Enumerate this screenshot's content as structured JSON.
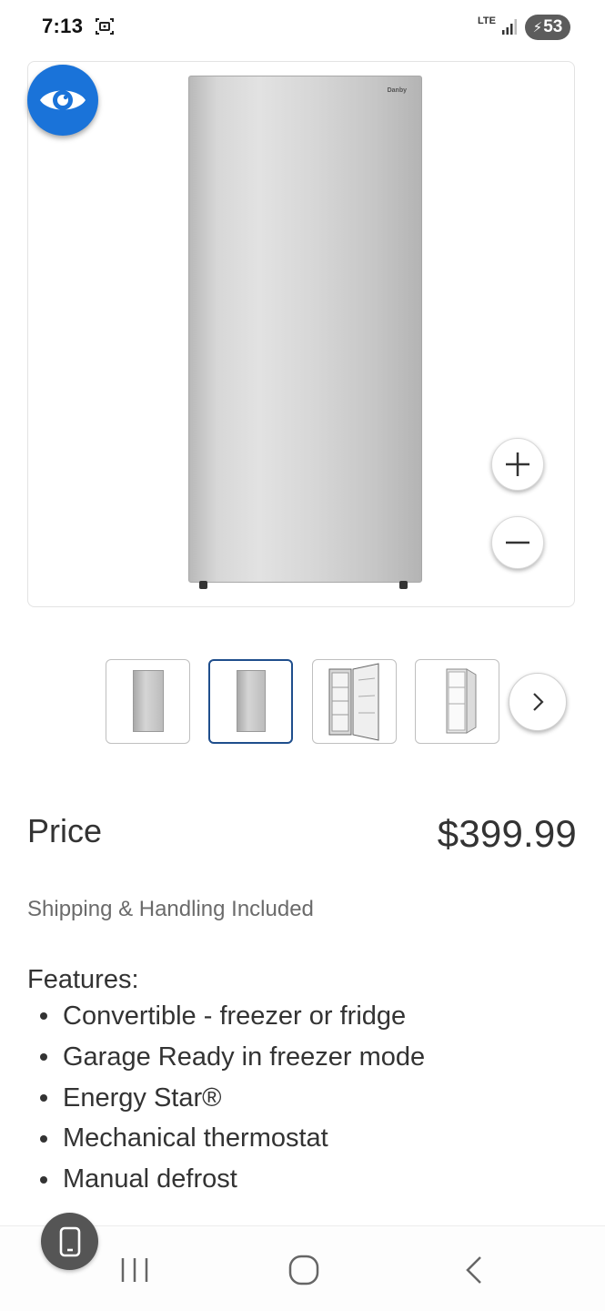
{
  "status_bar": {
    "time": "7:13",
    "network": "LTE",
    "battery_level": "53",
    "icons": [
      "screenshot-icon",
      "signal-icon",
      "charging-icon"
    ]
  },
  "viewer": {
    "brand_label": "Danby",
    "icons": [
      "eye-icon",
      "zoom-in-icon",
      "zoom-out-icon"
    ]
  },
  "thumbnails": {
    "count": 4,
    "selected_index": 1,
    "next_icon": "chevron-right-icon"
  },
  "price": {
    "label": "Price",
    "value": "$399.99"
  },
  "shipping": "Shipping & Handling Included",
  "features": {
    "title": "Features:",
    "items": [
      "Convertible - freezer or fridge",
      "Garage Ready in freezer mode",
      "Energy Star®",
      "Mechanical thermostat",
      "Manual defrost"
    ]
  },
  "nav": {
    "icons": [
      "recents-icon",
      "home-icon",
      "back-icon",
      "device-icon"
    ]
  },
  "colors": {
    "accent_blue": "#1a73d9",
    "selected_border": "#1f4e8c",
    "text_primary": "#333333",
    "text_secondary": "#6b6b6b"
  }
}
